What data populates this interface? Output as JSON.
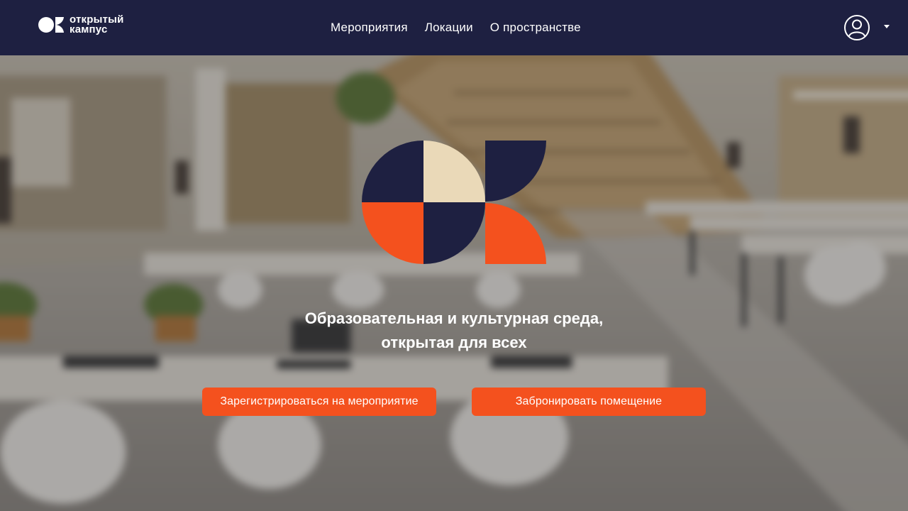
{
  "brand": {
    "line1": "открытый",
    "line2": "кампус"
  },
  "nav": {
    "items": [
      "Мероприятия",
      "Локации",
      "О пространстве"
    ]
  },
  "hero": {
    "tagline_line1": "Образовательная и культурная среда,",
    "tagline_line2": "открытая для всех",
    "register_button": "Зарегистрироваться на мероприятие",
    "book_button": "Забронировать помещение"
  },
  "colors": {
    "navy": "#1e2041",
    "orange": "#f4511e",
    "cream": "#ead9b8",
    "white": "#ffffff"
  },
  "icons": {
    "user": "user-circle-icon",
    "caret": "chevron-down-icon"
  }
}
